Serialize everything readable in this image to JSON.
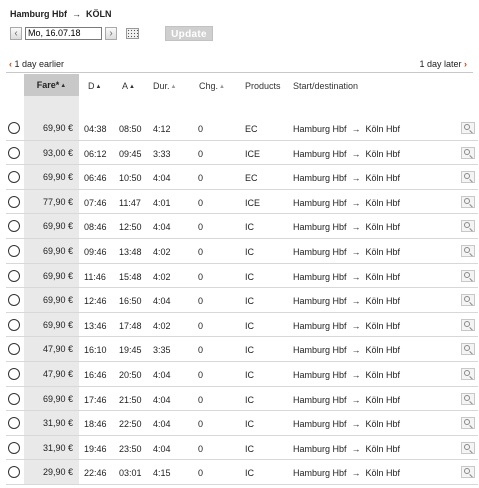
{
  "header": {
    "origin": "Hamburg Hbf",
    "destination": "KÖLN",
    "arrow": "→",
    "date_value": "Mo, 16.07.18",
    "prev_glyph": "‹",
    "next_glyph": "›",
    "update_label": "Update"
  },
  "nav": {
    "earlier_label": "1 day earlier",
    "later_label": "1 day later",
    "earlier_glyph": "‹",
    "later_glyph": "›"
  },
  "columns": {
    "fare": "Fare*",
    "dep": "D",
    "arr": "A",
    "dur": "Dur.",
    "chg": "Chg.",
    "products": "Products",
    "dest": "Start/destination",
    "sort_glyph": "▲"
  },
  "rows": [
    {
      "fare": "69,90 €",
      "dep": "04:38",
      "arr": "08:50",
      "dur": "4:12",
      "chg": "0",
      "prod": "EC",
      "from": "Hamburg Hbf",
      "to": "Köln Hbf"
    },
    {
      "fare": "93,00 €",
      "dep": "06:12",
      "arr": "09:45",
      "dur": "3:33",
      "chg": "0",
      "prod": "ICE",
      "from": "Hamburg Hbf",
      "to": "Köln Hbf"
    },
    {
      "fare": "69,90 €",
      "dep": "06:46",
      "arr": "10:50",
      "dur": "4:04",
      "chg": "0",
      "prod": "EC",
      "from": "Hamburg Hbf",
      "to": "Köln Hbf"
    },
    {
      "fare": "77,90 €",
      "dep": "07:46",
      "arr": "11:47",
      "dur": "4:01",
      "chg": "0",
      "prod": "ICE",
      "from": "Hamburg Hbf",
      "to": "Köln Hbf"
    },
    {
      "fare": "69,90 €",
      "dep": "08:46",
      "arr": "12:50",
      "dur": "4:04",
      "chg": "0",
      "prod": "IC",
      "from": "Hamburg Hbf",
      "to": "Köln Hbf"
    },
    {
      "fare": "69,90 €",
      "dep": "09:46",
      "arr": "13:48",
      "dur": "4:02",
      "chg": "0",
      "prod": "IC",
      "from": "Hamburg Hbf",
      "to": "Köln Hbf"
    },
    {
      "fare": "69,90 €",
      "dep": "11:46",
      "arr": "15:48",
      "dur": "4:02",
      "chg": "0",
      "prod": "IC",
      "from": "Hamburg Hbf",
      "to": "Köln Hbf"
    },
    {
      "fare": "69,90 €",
      "dep": "12:46",
      "arr": "16:50",
      "dur": "4:04",
      "chg": "0",
      "prod": "IC",
      "from": "Hamburg Hbf",
      "to": "Köln Hbf"
    },
    {
      "fare": "69,90 €",
      "dep": "13:46",
      "arr": "17:48",
      "dur": "4:02",
      "chg": "0",
      "prod": "IC",
      "from": "Hamburg Hbf",
      "to": "Köln Hbf"
    },
    {
      "fare": "47,90 €",
      "dep": "16:10",
      "arr": "19:45",
      "dur": "3:35",
      "chg": "0",
      "prod": "IC",
      "from": "Hamburg Hbf",
      "to": "Köln Hbf"
    },
    {
      "fare": "47,90 €",
      "dep": "16:46",
      "arr": "20:50",
      "dur": "4:04",
      "chg": "0",
      "prod": "IC",
      "from": "Hamburg Hbf",
      "to": "Köln Hbf"
    },
    {
      "fare": "69,90 €",
      "dep": "17:46",
      "arr": "21:50",
      "dur": "4:04",
      "chg": "0",
      "prod": "IC",
      "from": "Hamburg Hbf",
      "to": "Köln Hbf"
    },
    {
      "fare": "31,90 €",
      "dep": "18:46",
      "arr": "22:50",
      "dur": "4:04",
      "chg": "0",
      "prod": "IC",
      "from": "Hamburg Hbf",
      "to": "Köln Hbf"
    },
    {
      "fare": "31,90 €",
      "dep": "19:46",
      "arr": "23:50",
      "dur": "4:04",
      "chg": "0",
      "prod": "IC",
      "from": "Hamburg Hbf",
      "to": "Köln Hbf"
    },
    {
      "fare": "29,90 €",
      "dep": "22:46",
      "arr": "03:01",
      "dur": "4:15",
      "chg": "0",
      "prod": "IC",
      "from": "Hamburg Hbf",
      "to": "Köln Hbf"
    }
  ],
  "icons": {
    "row_details": "magnifier-icon",
    "calendar": "calendar-icon"
  },
  "colors": {
    "accent": "#d0400f",
    "fare_header_bg": "#c8c8c8",
    "fare_cell_bg": "#e9e9e9",
    "update_bg": "#cfcfcf"
  }
}
